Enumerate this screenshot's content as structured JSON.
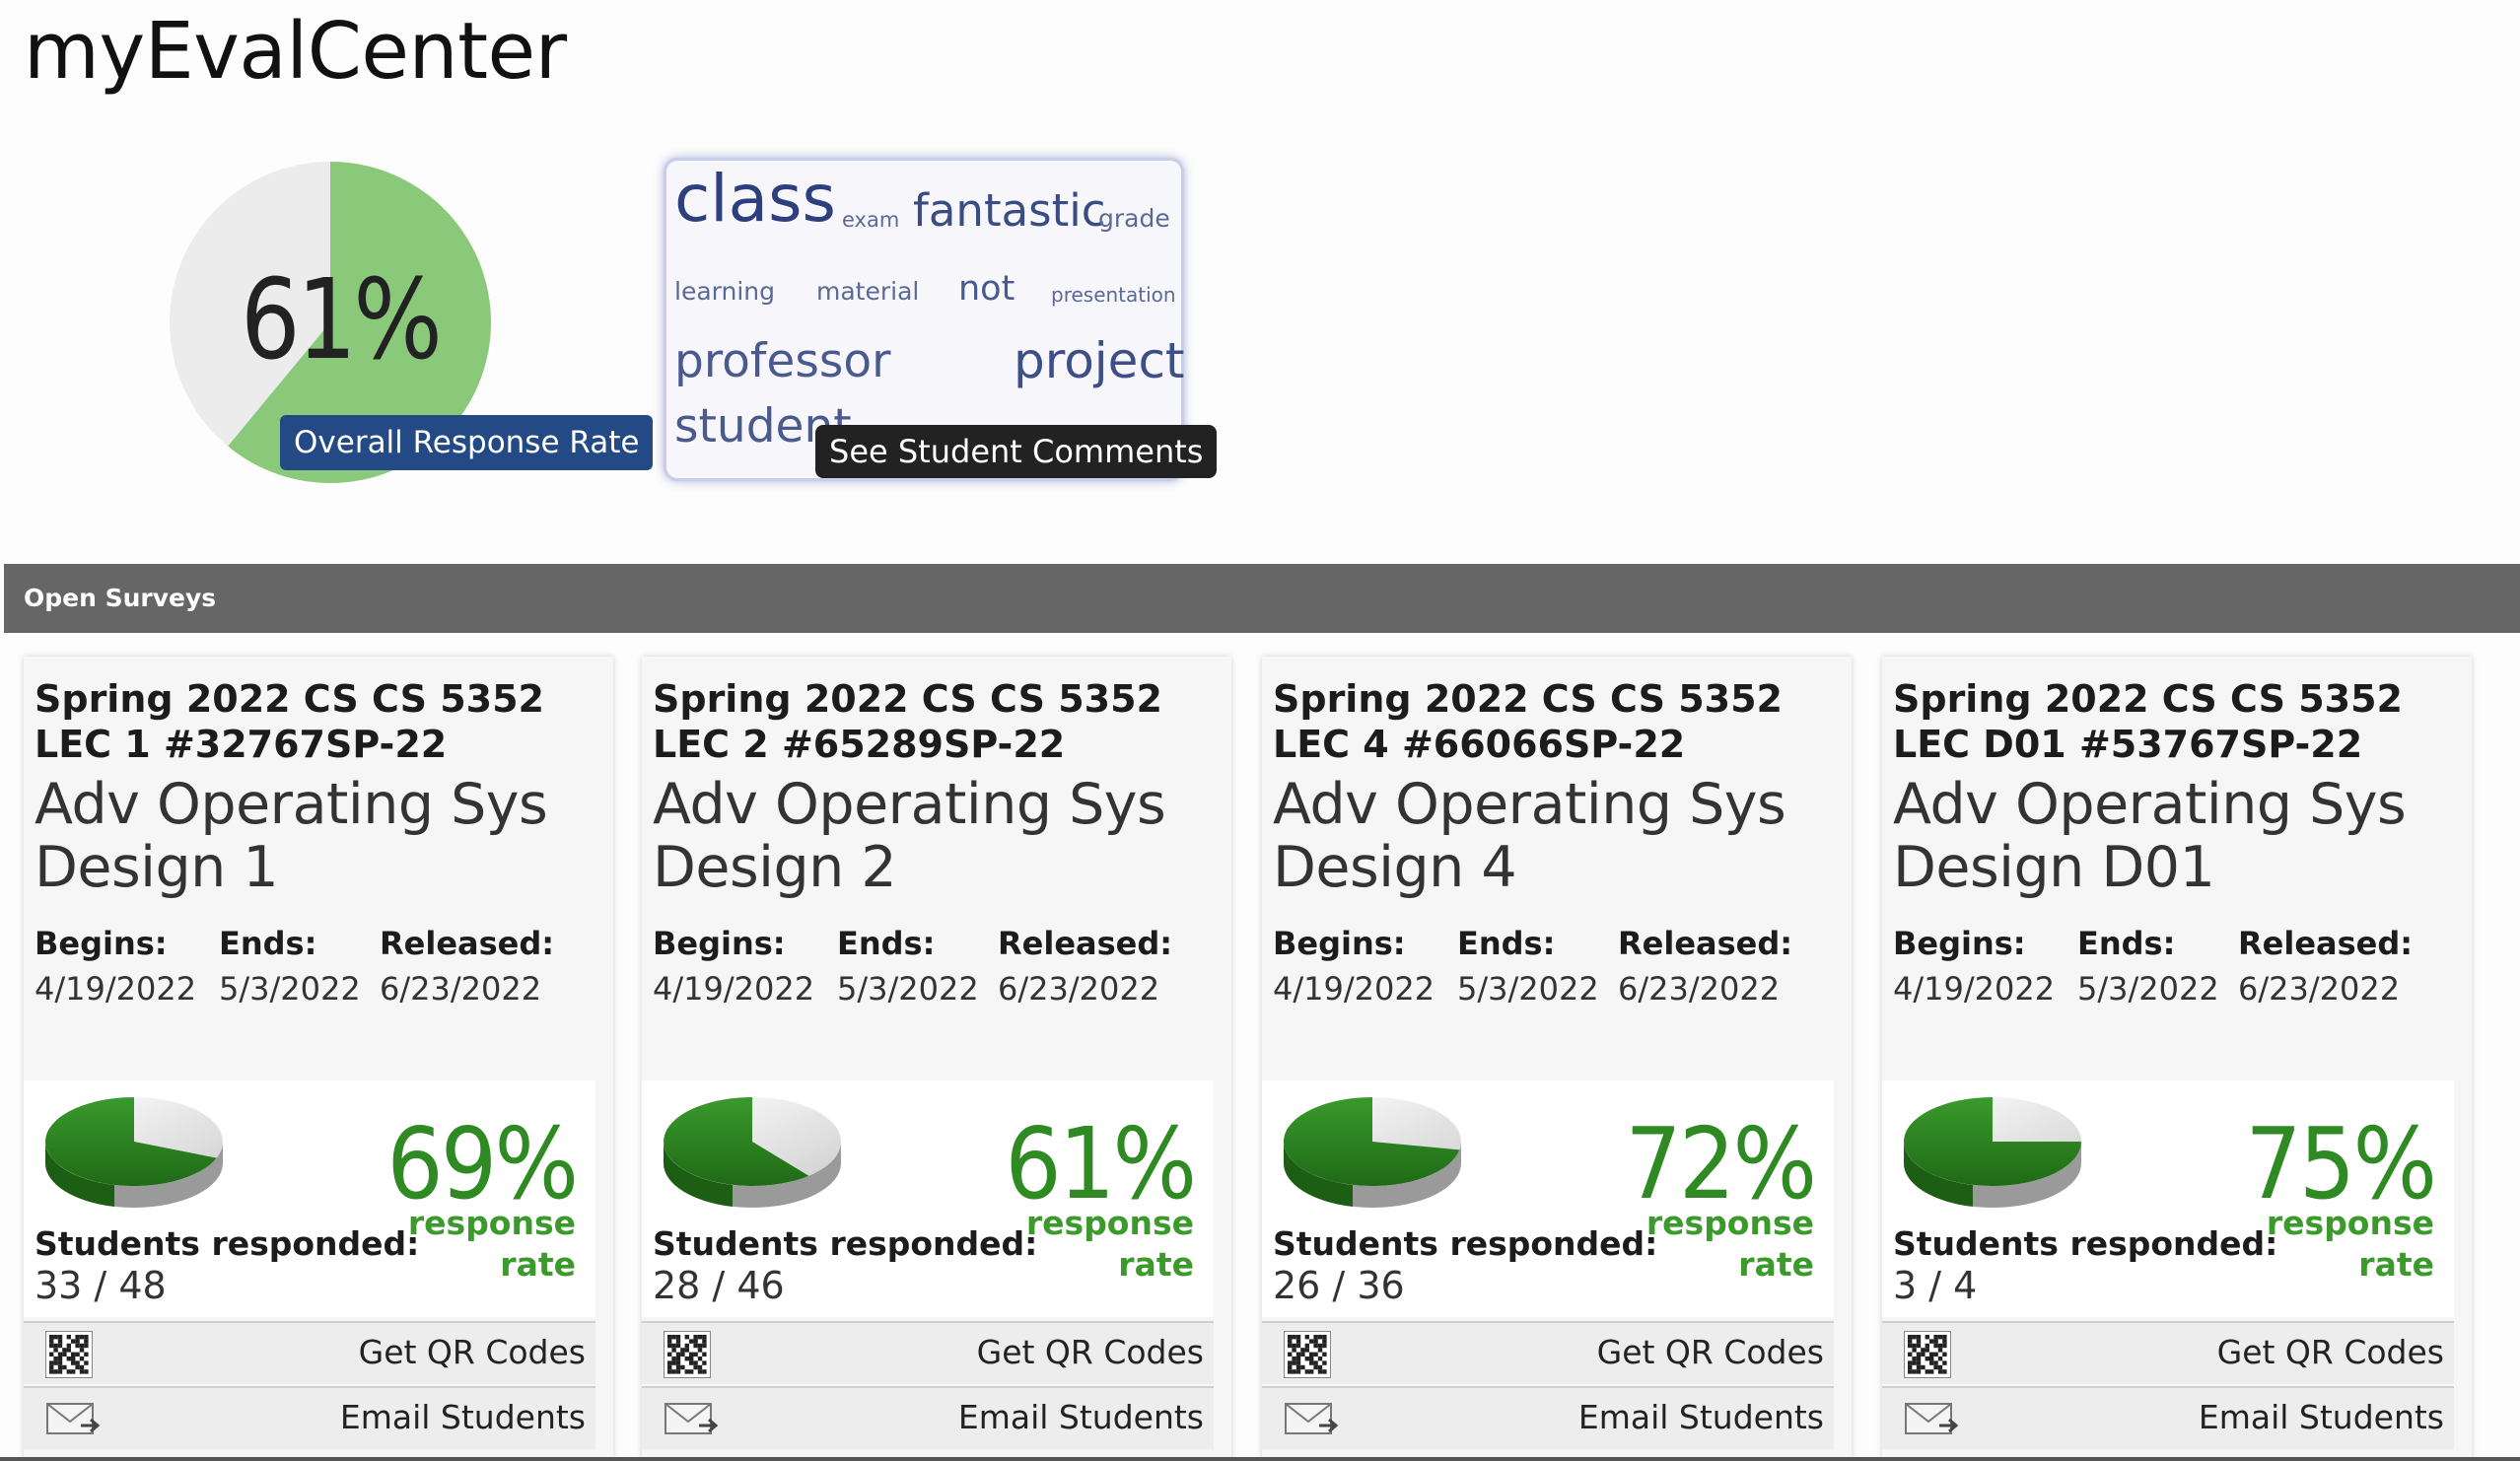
{
  "app": {
    "title": "myEvalCenter"
  },
  "overall": {
    "percent": "61%",
    "value": 0.61,
    "label": "Overall Response Rate"
  },
  "word_cloud": {
    "words": [
      "class",
      "exam",
      "fantastic",
      "grade",
      "learning",
      "material",
      "not",
      "presentation",
      "professor",
      "project",
      "student"
    ],
    "tooltip": "See Student Comments"
  },
  "section": {
    "title": "Open Surveys"
  },
  "labels": {
    "begins": "Begins:",
    "ends": "Ends:",
    "released": "Released:",
    "students_responded": "Students responded:",
    "response": "response",
    "rate": "rate",
    "qr": "Get QR Codes",
    "email": "Email Students"
  },
  "colors": {
    "accent_green": "#2f8a24",
    "badge_blue": "#244a86",
    "header_gray": "#666666"
  },
  "surveys": [
    {
      "code": "Spring 2022 CS CS 5352 LEC 1 #32767SP-22",
      "name": "Adv Operating Sys Design 1",
      "begins": "4/19/2022",
      "ends": "5/3/2022",
      "released": "6/23/2022",
      "percent": "69%",
      "value": 0.69,
      "responded": "33 / 48"
    },
    {
      "code": "Spring 2022 CS CS 5352 LEC 2 #65289SP-22",
      "name": "Adv Operating Sys Design 2",
      "begins": "4/19/2022",
      "ends": "5/3/2022",
      "released": "6/23/2022",
      "percent": "61%",
      "value": 0.61,
      "responded": "28 / 46"
    },
    {
      "code": "Spring 2022 CS CS 5352 LEC 4 #66066SP-22",
      "name": "Adv Operating Sys Design 4",
      "begins": "4/19/2022",
      "ends": "5/3/2022",
      "released": "6/23/2022",
      "percent": "72%",
      "value": 0.72,
      "responded": "26 / 36"
    },
    {
      "code": "Spring 2022 CS CS 5352 LEC D01 #53767SP-22",
      "name": "Adv Operating Sys Design D01",
      "begins": "4/19/2022",
      "ends": "5/3/2022",
      "released": "6/23/2022",
      "percent": "75%",
      "value": 0.75,
      "responded": "3 / 4"
    }
  ]
}
